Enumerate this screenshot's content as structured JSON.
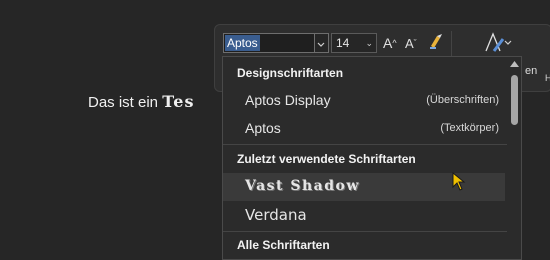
{
  "document": {
    "line_plain": "Das ist ein ",
    "line_fancy": "Tes"
  },
  "toolbar": {
    "font_name_value": "Aptos",
    "font_size_value": "14",
    "grow_label": "A",
    "shrink_label": "A",
    "edge_right": "en",
    "edge_right2": "H"
  },
  "menu": {
    "design_header": "Designschriftarten",
    "design_items": [
      {
        "name": "Aptos Display",
        "tag": "(Überschriften)"
      },
      {
        "name": "Aptos",
        "tag": "(Textkörper)"
      }
    ],
    "recent_header": "Zuletzt verwendete Schriftarten",
    "recent_items": [
      {
        "name": "Vast Shadow"
      },
      {
        "name": "Verdana"
      }
    ],
    "all_header": "Alle Schriftarten"
  },
  "colors": {
    "background": "#262626",
    "menu_bg": "#2b2b2b",
    "selection": "#3a5d8f",
    "cursor": "#f0c000"
  }
}
